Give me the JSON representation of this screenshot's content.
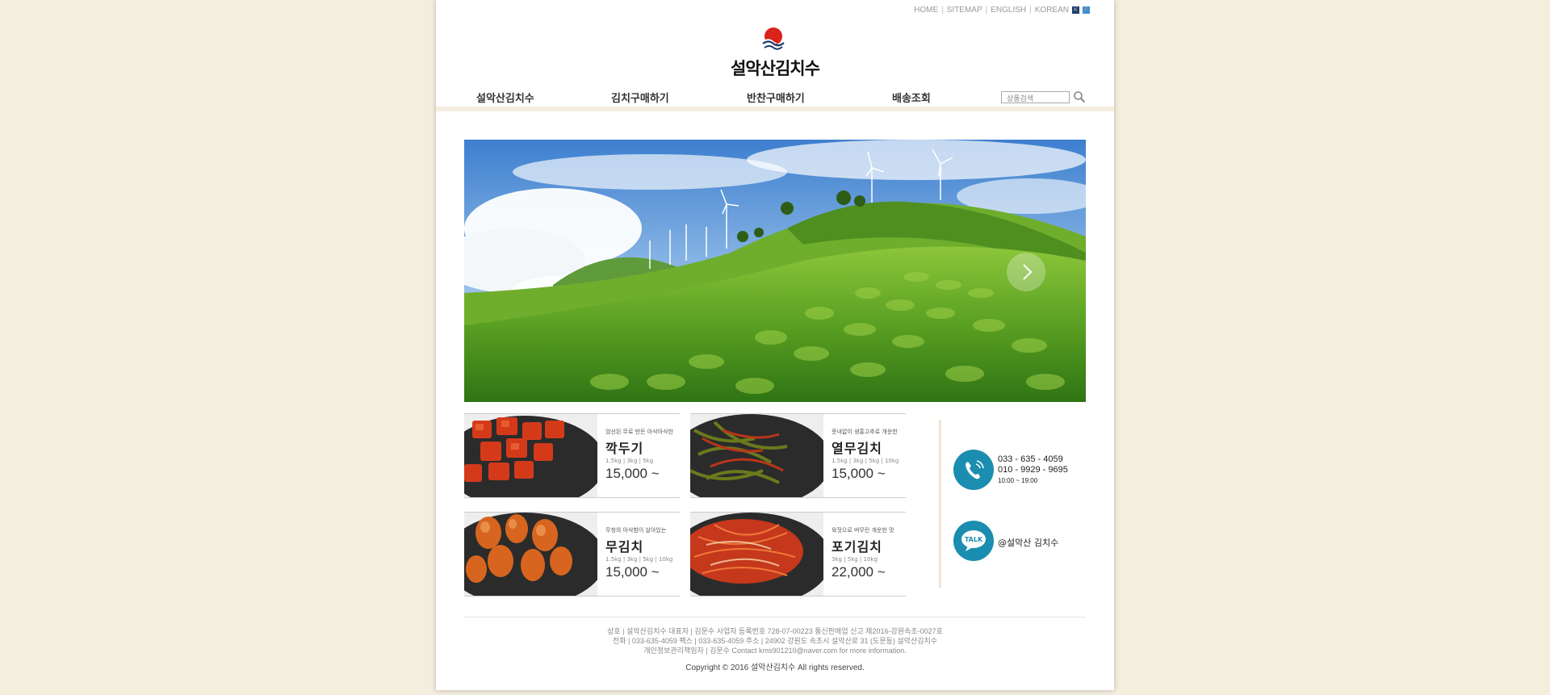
{
  "top_links": {
    "home": "HOME",
    "sitemap": "SITEMAP",
    "english": "ENGLISH",
    "korean": "KOREAN",
    "k_badge": "K",
    "f_badge": "F"
  },
  "logo": {
    "text": "설악산김치수"
  },
  "nav": {
    "items": [
      "설악산김치수",
      "김치구매하기",
      "반찬구매하기",
      "배송조회"
    ],
    "search_placeholder": "상품검색"
  },
  "products": [
    {
      "tag": "엄선된 무로 만든 아삭아삭한",
      "name": "깍두기",
      "weights": "1.5kg  |  3kg  |  5kg",
      "price": "15,000 ~"
    },
    {
      "tag": "풋내없이 생홍고추로 개운한",
      "name": "열무김치",
      "weights": "1.5kg | 3kg | 5kg | 10kg",
      "price": "15,000 ~"
    },
    {
      "tag": "무청의 아삭함이 살아있는",
      "name": "무김치",
      "weights": "1.5kg | 3kg | 5kg | 10kg",
      "price": "15,000 ~"
    },
    {
      "tag": "육젓으로 버무린 개운한 맛",
      "name": "포기김치",
      "weights": "3kg  |  5kg  |  10kg",
      "price": "22,000 ~"
    }
  ],
  "contact": {
    "phone1": "033 - 635 - 4059",
    "phone2": "010 - 9929 - 9695",
    "hours": "10:00 ~ 19:00",
    "talk_badge": "TALK",
    "talk_id": "@설악산 김치수"
  },
  "footer": {
    "line1": "상호 | 설악산김치수      대표자 | 김문수      사업자 등록번호 728-07-00223      통신판매업 신고 제2016-강원속초-0027호",
    "line2": "전화 | 033-635-4059      팩스 | 033-635-4059      주소 | 24902 강원도 속초시 설악산로 31 (도문동) 설악산김치수",
    "line3": "개인정보관리책임자 | 김문수      Contact kms901210@naver.com for more information.",
    "copyright": "Copyright © 2016 설악산김치수 All rights reserved."
  },
  "colors": {
    "background": "#f4eedf",
    "accent_blue": "#1b8db0",
    "logo_red": "#d9231b"
  }
}
